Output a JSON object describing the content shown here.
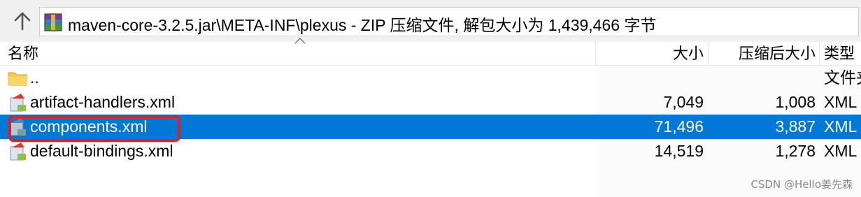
{
  "address": {
    "path": "maven-core-3.2.5.jar\\META-INF\\plexus - ZIP 压缩文件, 解包大小为 1,439,466 字节",
    "up_icon": "up-arrow-icon",
    "archive_icon": "winrar-archive-icon"
  },
  "columns": {
    "name": "名称",
    "size": "大小",
    "packed": "压缩后大小",
    "type": "类型"
  },
  "rows": [
    {
      "name": "..",
      "size": "",
      "packed": "",
      "type": "文件夹",
      "icon": "folder-icon",
      "selected": false
    },
    {
      "name": "artifact-handlers.xml",
      "size": "7,049",
      "packed": "1,008",
      "type": "XML",
      "icon": "xml-file-icon",
      "selected": false
    },
    {
      "name": "components.xml",
      "size": "71,496",
      "packed": "3,887",
      "type": "XML",
      "icon": "xml-file-icon",
      "selected": true
    },
    {
      "name": "default-bindings.xml",
      "size": "14,519",
      "packed": "1,278",
      "type": "XML",
      "icon": "xml-file-icon",
      "selected": false
    }
  ],
  "watermark": "CSDN @Hello姜先森",
  "colors": {
    "selection": "#0078d7",
    "annotation": "#e02020"
  }
}
